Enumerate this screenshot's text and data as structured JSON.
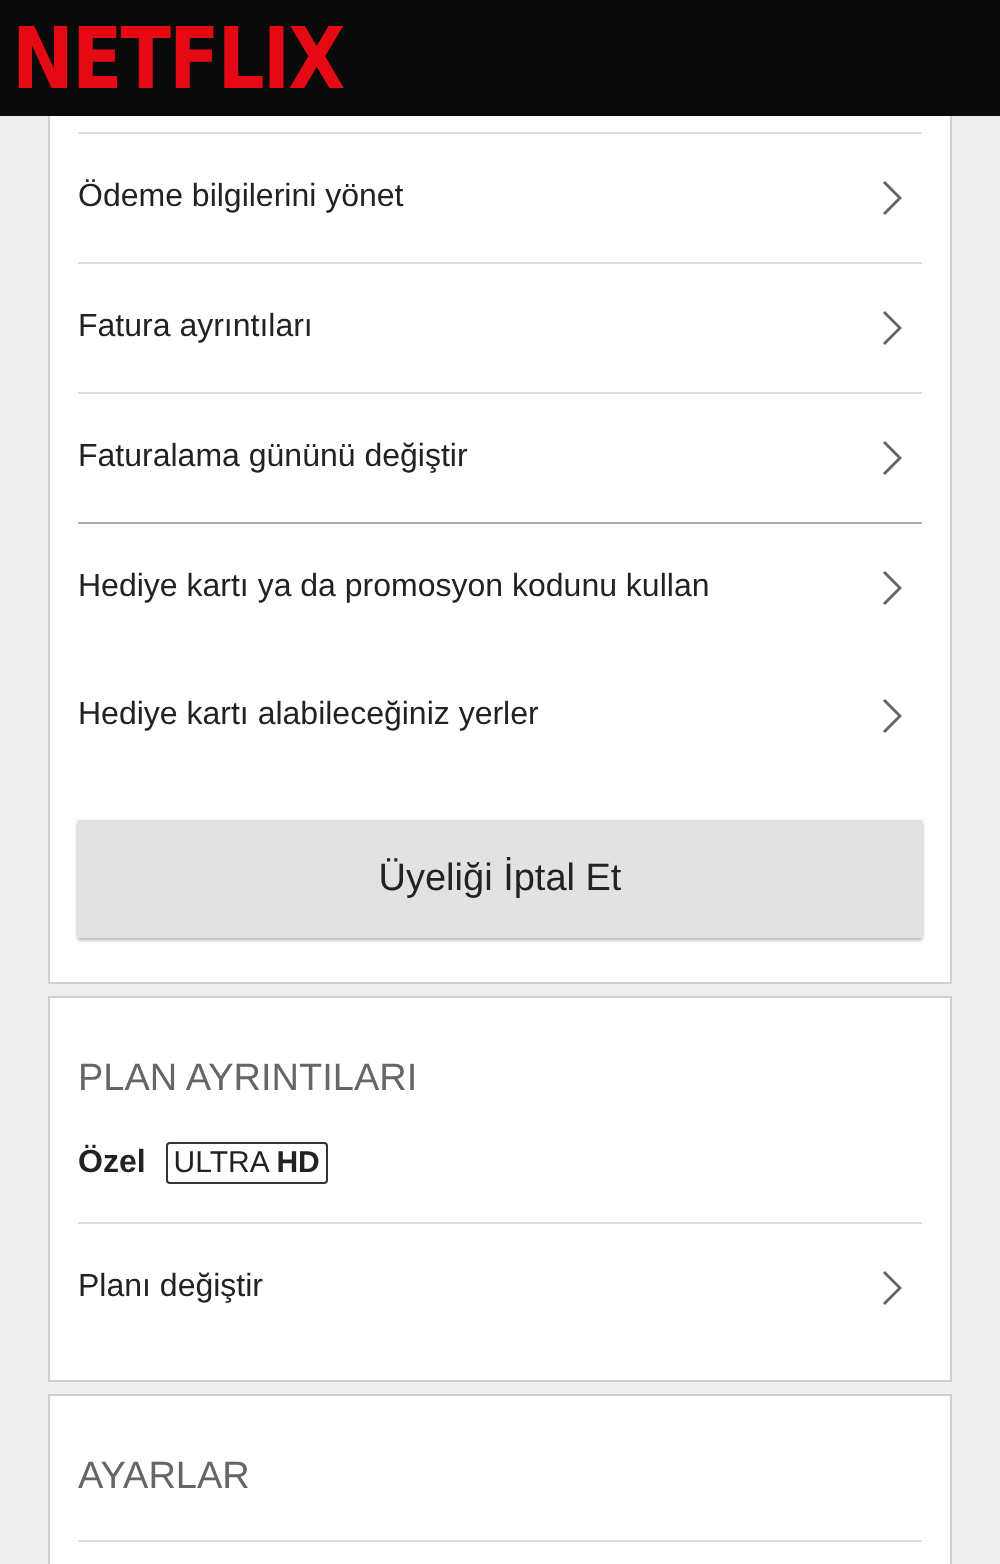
{
  "header": {
    "logo": "NETFLIX"
  },
  "billing": {
    "groups": [
      {
        "divided": true,
        "items": [
          {
            "label": "Ödeme bilgilerini yönet"
          },
          {
            "label": "Fatura ayrıntıları"
          },
          {
            "label": "Faturalama gününü değiştir"
          }
        ]
      },
      {
        "divided": false,
        "items": [
          {
            "label": "Hediye kartı ya da promosyon kodunu kullan"
          },
          {
            "label": "Hediye kartı alabileceğiniz yerler"
          }
        ]
      }
    ],
    "cancel_button": "Üyeliği İptal Et"
  },
  "plan": {
    "heading": "PLAN AYRINTILARI",
    "name": "Özel",
    "badge": "ULTRA **HD**",
    "items": [
      {
        "label": "Planı değiştir"
      }
    ]
  },
  "settings": {
    "heading": "AYARLAR"
  }
}
